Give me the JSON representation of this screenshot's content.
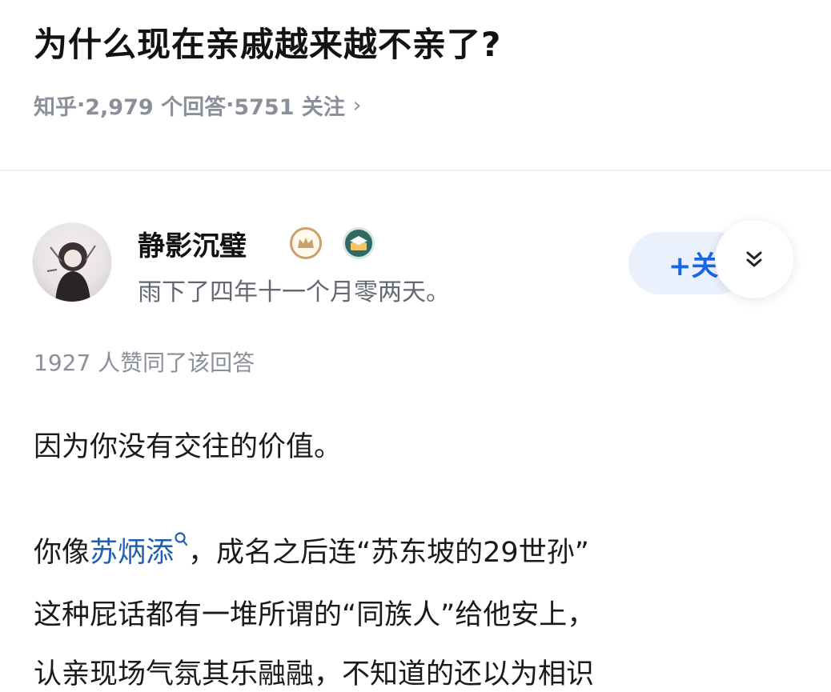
{
  "question": {
    "title": "为什么现在亲戚越来越不亲了?",
    "source": "知乎",
    "answers_count": "2,979 个回答",
    "followers": "5751 关注",
    "sep": " · "
  },
  "author": {
    "name": "静影沉璧",
    "bio": "雨下了四年十一个月零两天。",
    "follow_label": "+关"
  },
  "answer": {
    "votes": "1927 人赞同了该回答",
    "p1": "因为你没有交往的价值。",
    "l1_pre": "你像",
    "l1_link": "苏炳添",
    "l1_post": "，成名之后连“苏东坡的29世孙”",
    "l2": "这种屁话都有一堆所谓的“同族人”给他安上，",
    "l3": "认亲现场气氛其乐融融，不知道的还以为相识"
  },
  "colors": {
    "link": "#1d5fb3",
    "follow_bg": "#eaf1fd",
    "follow_text": "#1766e5",
    "meta_gray": "#8a8f99"
  },
  "icons": [
    "chevron-right-icon",
    "crown-badge-icon",
    "education-badge-icon",
    "double-chevron-down-icon",
    "search-icon"
  ]
}
